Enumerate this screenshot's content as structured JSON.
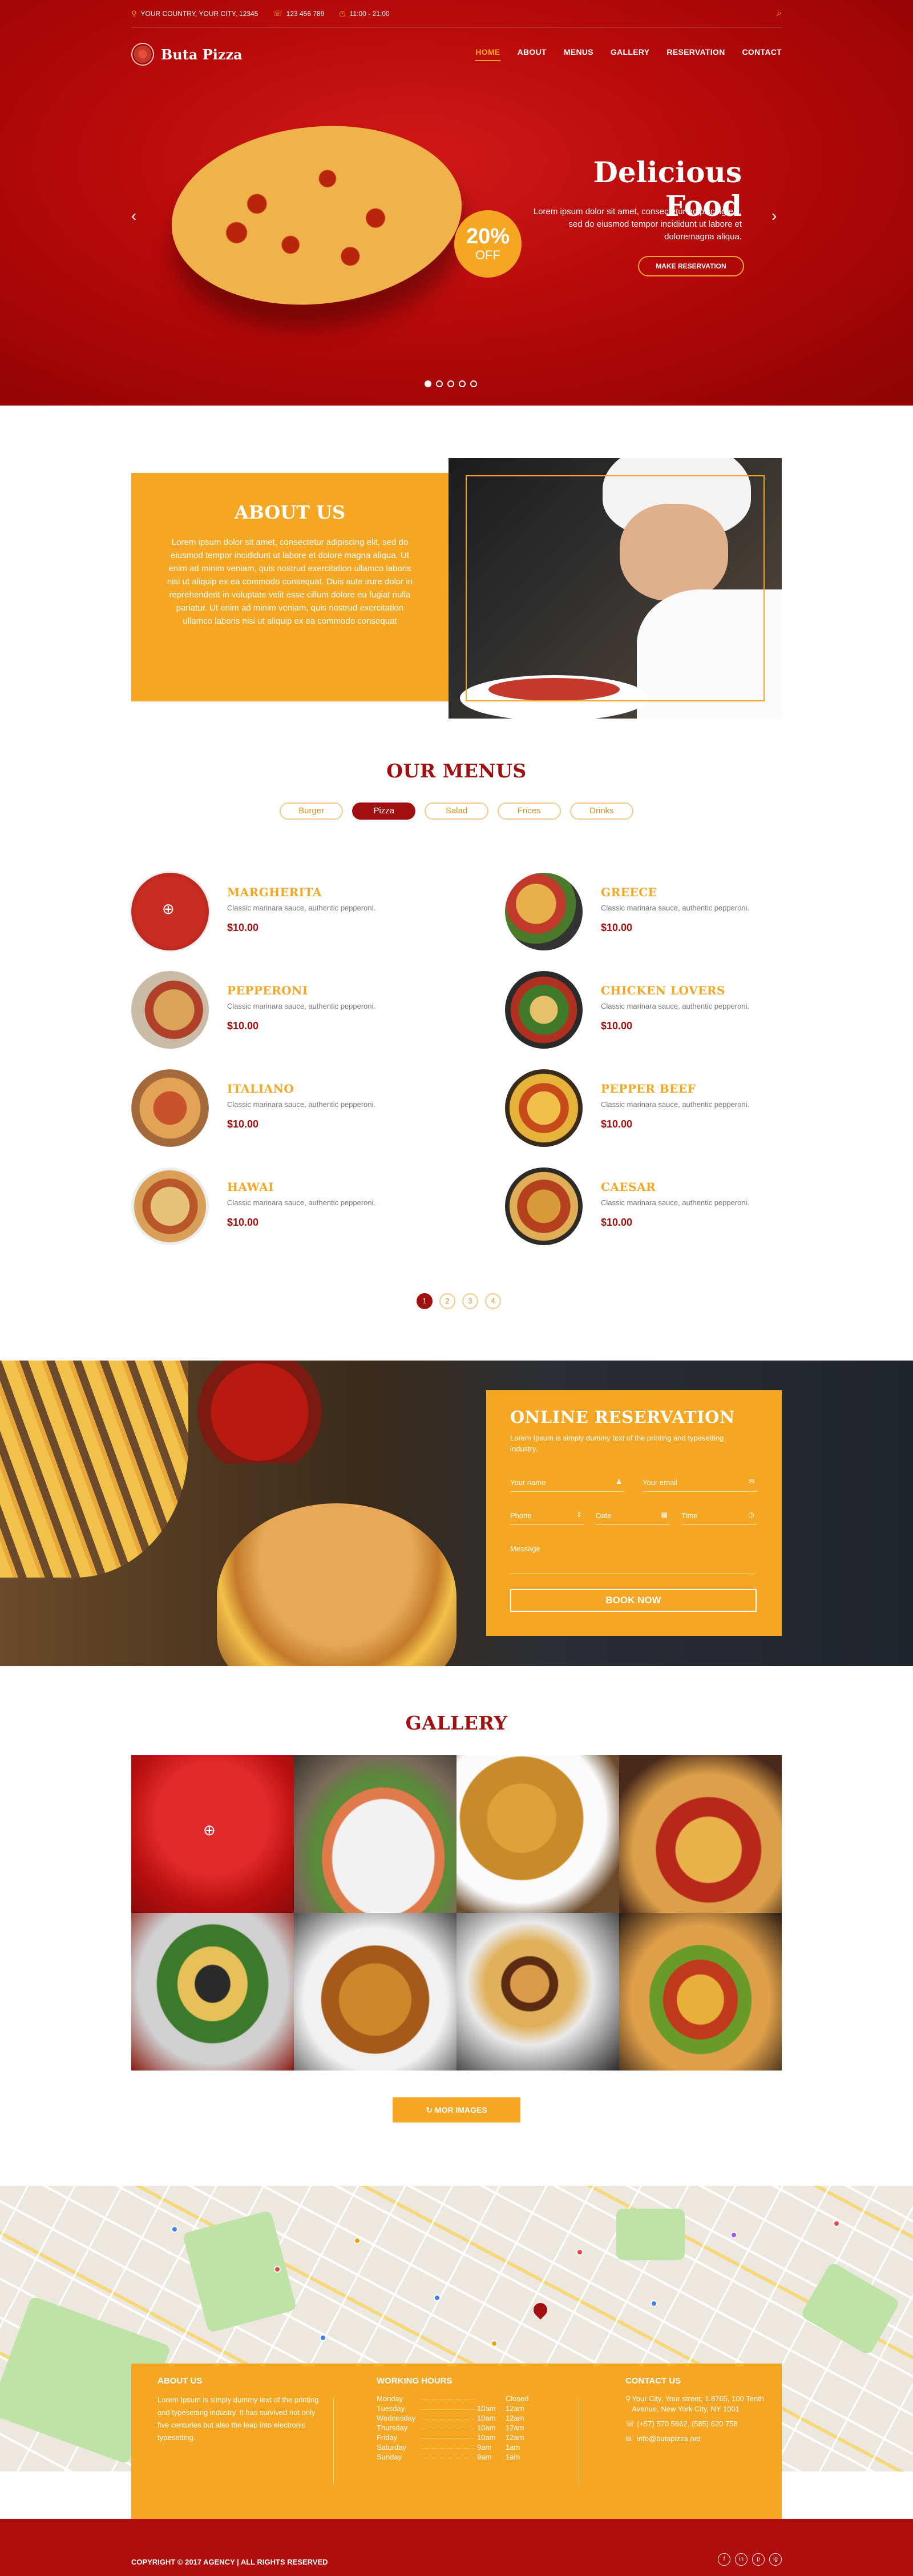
{
  "topbar": {
    "location": "YOUR COUNTRY, YOUR CITY, 12345",
    "phone": "123 456 789",
    "hours": "11:00 - 21:00"
  },
  "brand": {
    "name": "Buta Pizza"
  },
  "nav": [
    "HOME",
    "ABOUT",
    "MENUS",
    "GALLERY",
    "RESERVATION",
    "CONTACT"
  ],
  "hero": {
    "title": "Delicious Food",
    "text": "Lorem ipsum dolor sit amet, consectetur adipiscing elit, sed do eiusmod tempor incididunt ut labore et doloremagna aliqua.",
    "button": "MAKE RESERVATION",
    "badge_value": "20%",
    "badge_label": "OFF",
    "slide_count": 5,
    "active_slide": 1
  },
  "about": {
    "title": "ABOUT US",
    "text": "Lorem ipsum dolor sit amet, consectetur adipiscing elit, sed do eiusmod tempor incididunt ut labore et dolore magna aliqua. Ut enim ad minim veniam, quis nostrud exercitation ullamco laboris nisi ut aliquip ex ea commodo consequat. Duis aute irure dolor in reprehenderit in voluptate velit esse cillum dolore eu fugiat nulla pariatur. Ut enim ad minim veniam, quis nostrud exercitation ullamco laboris nisi ut aliquip ex ea commodo consequat"
  },
  "menus": {
    "title": "OUR MENUS",
    "tabs": [
      "Burger",
      "Pizza",
      "Salad",
      "Frices",
      "Drinks"
    ],
    "active_tab": "Pizza",
    "items": [
      {
        "name": "MARGHERITA",
        "desc": "Classic marinara sauce, authentic pepperoni.",
        "price": "$10.00"
      },
      {
        "name": "GREECE",
        "desc": "Classic marinara sauce, authentic pepperoni.",
        "price": "$10.00"
      },
      {
        "name": "PEPPERONI",
        "desc": "Classic marinara sauce, authentic pepperoni.",
        "price": "$10.00"
      },
      {
        "name": "CHICKEN LOVERS",
        "desc": "Classic marinara sauce, authentic pepperoni.",
        "price": "$10.00"
      },
      {
        "name": "ITALIANO",
        "desc": "Classic marinara sauce, authentic pepperoni.",
        "price": "$10.00"
      },
      {
        "name": "PEPPER BEEF",
        "desc": "Classic marinara sauce, authentic pepperoni.",
        "price": "$10.00"
      },
      {
        "name": "HAWAI",
        "desc": "Classic marinara sauce, authentic pepperoni.",
        "price": "$10.00"
      },
      {
        "name": "CAESAR",
        "desc": "Classic marinara sauce, authentic pepperoni.",
        "price": "$10.00"
      }
    ],
    "pages": [
      "1",
      "2",
      "3",
      "4"
    ],
    "active_page": "1"
  },
  "reservation": {
    "title": "ONLINE RESERVATION",
    "lead": "Lorem Ipsum is simply dummy text of the printing and typesetting industry.",
    "fields": {
      "name": "Your name",
      "email": "Your email",
      "phone": "Phone",
      "date": "Date",
      "time": "Time",
      "message": "Message"
    },
    "button": "BOOK NOW"
  },
  "gallery": {
    "title": "GALLERY",
    "images": [
      "salad with tomato sauce",
      "grilled salmon plate",
      "fried chicken nuggets",
      "sliced pizza",
      "taco salad bowl",
      "fried chicken pieces",
      "burger with fries",
      "beef tacos"
    ],
    "more_button": "MOR IMAGES"
  },
  "footer": {
    "about_title": "ABOUT US",
    "about_text": "Lorem Ipsum is simply dummy text of the printing and typesetting industry. It has survived not only five centuries but also the leap into electronic typesetting.",
    "hours_title": "WORKING HOURS",
    "hours": [
      {
        "day": "Monday",
        "open": "",
        "close": "Closed"
      },
      {
        "day": "Tuesday",
        "open": "10am",
        "close": "12am"
      },
      {
        "day": "Wednesday",
        "open": "10am",
        "close": "12am"
      },
      {
        "day": "Thursday",
        "open": "10am",
        "close": "12am"
      },
      {
        "day": "Friday",
        "open": "10am",
        "close": "12am"
      },
      {
        "day": "Saturday",
        "open": "9am",
        "close": "1am"
      },
      {
        "day": "Sunday",
        "open": "9am",
        "close": "1am"
      }
    ],
    "contact_title": "CONTACT US",
    "address": "Your City, Your street, 1.8765, 100 Tenth Avenue, New York City, NY 1001",
    "phones": "(+57) 570 5662, (585) 620 758",
    "email": "info@butapizza.net",
    "copyright": "COPYRIGHT © 2017 AGENCY  |  ALL RIGHTS RESERVED",
    "social": [
      "f",
      "in",
      "p",
      "ig"
    ]
  },
  "colors": {
    "primary_red": "#a10f0f",
    "accent_orange": "#f5a623"
  }
}
